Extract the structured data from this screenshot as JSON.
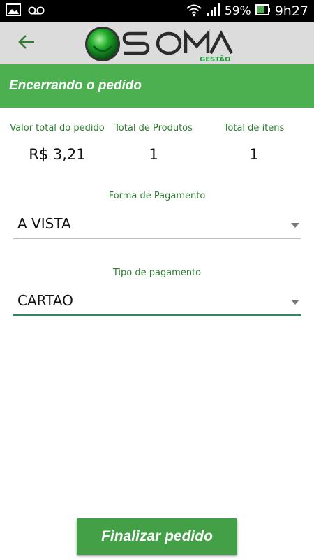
{
  "status_bar": {
    "battery": "59%",
    "time": "9h27",
    "icons": [
      "image-icon",
      "voicemail-icon",
      "wifi-icon",
      "signal-icon",
      "battery-icon"
    ]
  },
  "app_bar": {
    "logo_text": "SOMA",
    "logo_subtext": "GESTÃO",
    "back_icon": "arrow-left-icon",
    "accent": "#2e7d32"
  },
  "title": "Encerrando o pedido",
  "summary": {
    "total_value_label": "Valor total do pedido",
    "total_value": "R$ 3,21",
    "total_products_label": "Total de Produtos",
    "total_products": "1",
    "total_items_label": "Total de itens",
    "total_items": "1"
  },
  "payment_form": {
    "label": "Forma de Pagamento",
    "selected": "A VISTA"
  },
  "payment_type": {
    "label": "Tipo de pagamento",
    "selected": "CARTAO"
  },
  "finish_button": "Finalizar pedido",
  "colors": {
    "primary": "#4caf50",
    "button": "#43a047",
    "label": "#2e7d32",
    "header_bg": "#dcdcdc"
  }
}
